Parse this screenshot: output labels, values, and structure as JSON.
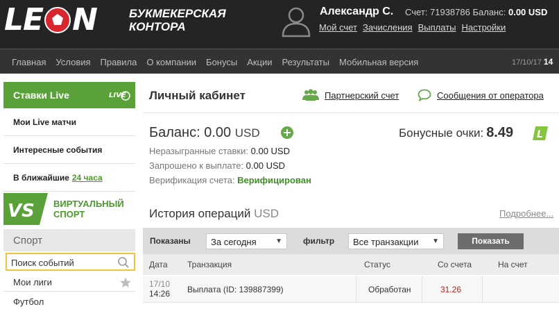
{
  "header": {
    "logo_text": [
      "LE",
      "N"
    ],
    "tagline": [
      "букмекерская",
      "контора"
    ],
    "user_name": "Александр С.",
    "account_label": "Счет:",
    "account_number": "71938786",
    "balance_label": "Баланс:",
    "balance_value": "0.00 USD",
    "links": [
      "Мой счет",
      "Зачисления",
      "Выплаты",
      "Настройки"
    ]
  },
  "nav": {
    "items": [
      "Главная",
      "Условия",
      "Правила",
      "О компании",
      "Бонусы",
      "Акции",
      "Результаты",
      "Мобильная версия"
    ],
    "date": "17/10/17",
    "time": "14"
  },
  "sidebar": {
    "live_button": "Ставки Live",
    "live_icon_text": "LIVE",
    "items": [
      {
        "label": "Мои Live матчи"
      },
      {
        "label": "Интересные события"
      },
      {
        "label": "В ближайшие",
        "link": "24 часа"
      }
    ],
    "virtual_badge": "VS",
    "virtual_label": [
      "ВИРТУАЛЬНЫЙ",
      "СПОРТ"
    ],
    "sport_heading": "Спорт",
    "search_placeholder": "Поиск событий",
    "my_leagues": "Мои лиги",
    "football": "Футбол"
  },
  "main": {
    "title": "Личный кабинет",
    "partner_link": "Партнерский счет",
    "messages_link": "Сообщения от оператора",
    "balance_label": "Баланс:",
    "balance_value": "0.00",
    "balance_currency": "USD",
    "bonus_label": "Бонусные очки:",
    "bonus_value": "8.49",
    "bonus_icon_text": "L",
    "stats": [
      {
        "label": "Неразыгранные ставки:",
        "value": "0.00 USD"
      },
      {
        "label": "Запрошено к выплате:",
        "value": "0.00 USD"
      },
      {
        "label": "Верификация счета:",
        "value": "Верифицирован"
      }
    ],
    "history_title": "История операций",
    "history_currency": "USD",
    "more_link": "Подробнее...",
    "filter": {
      "show_label": "Показаны",
      "period": "За сегодня",
      "filter_label": "фильтр",
      "type": "Все транзакции",
      "button": "Показать"
    },
    "table": {
      "columns": [
        "Дата",
        "Транзакция",
        "Статус",
        "Со счета",
        "На счет"
      ],
      "rows": [
        {
          "date": "17/10",
          "time": "14:26",
          "transaction": "Выплата (ID: 139887399)",
          "status": "Обработан",
          "from": "31.26",
          "to": ""
        }
      ]
    }
  },
  "colors": {
    "accent_green": "#5aa13a",
    "header_bg": "#242424",
    "nav_bg": "#333333",
    "amount_red": "#b3281d",
    "search_border": "#f1c33f"
  }
}
